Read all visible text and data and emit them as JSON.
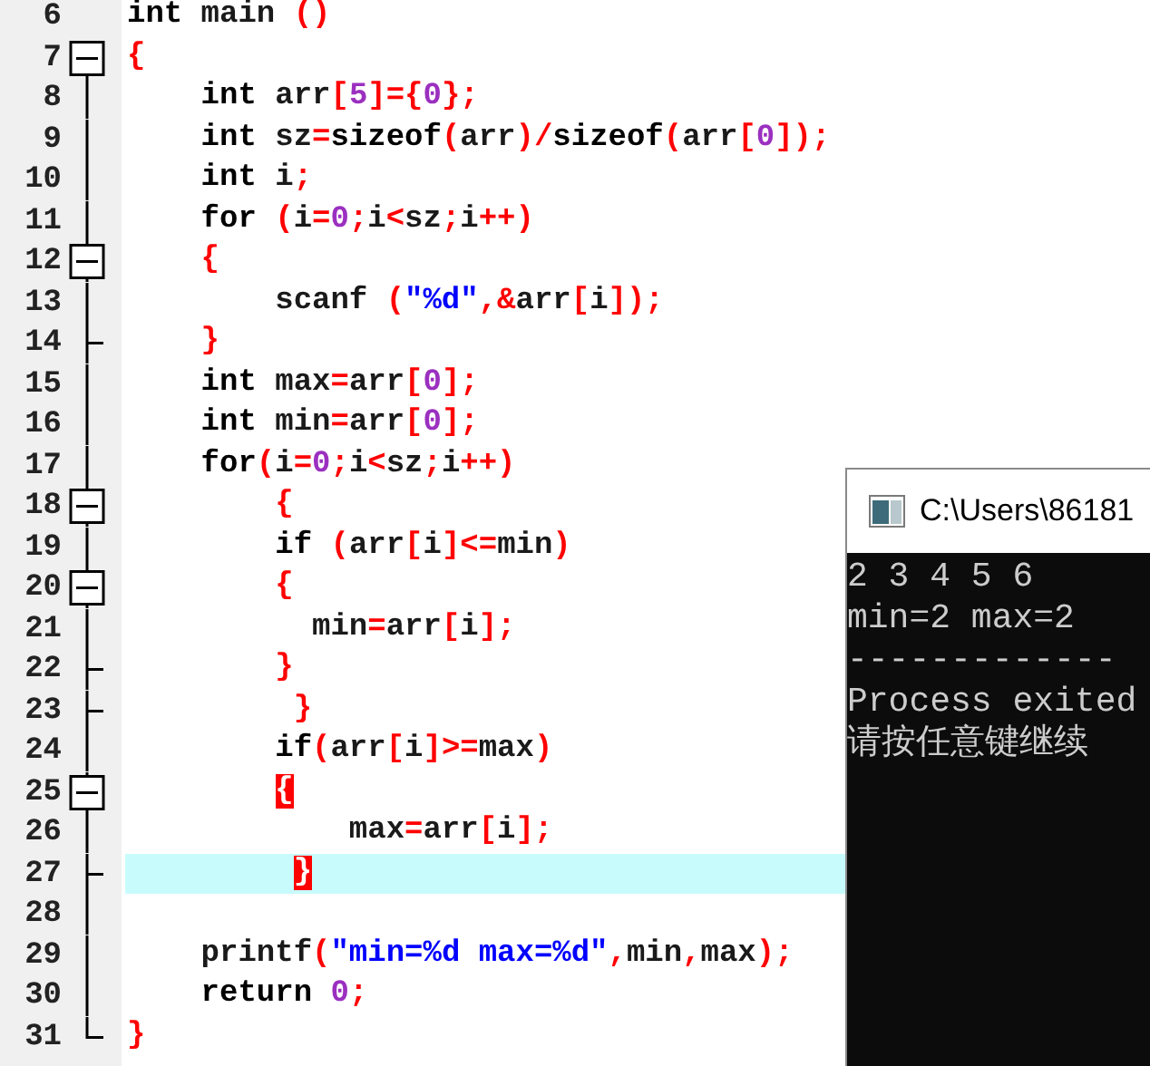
{
  "editor": {
    "lines": [
      {
        "number": "6",
        "kind": "plain",
        "current": false,
        "tokens": [
          {
            "text": "int",
            "kind": "kw"
          },
          {
            "text": " main ",
            "kind": "id"
          },
          {
            "text": "()",
            "kind": "op"
          }
        ]
      },
      {
        "number": "7",
        "kind": "open",
        "current": false,
        "tokens": [
          {
            "text": "{",
            "kind": "op"
          }
        ]
      },
      {
        "number": "8",
        "kind": "bar",
        "current": false,
        "tokens": [
          {
            "text": "    int",
            "kind": "kw"
          },
          {
            "text": " arr",
            "kind": "id"
          },
          {
            "text": "[",
            "kind": "op"
          },
          {
            "text": "5",
            "kind": "num"
          },
          {
            "text": "]={",
            "kind": "op"
          },
          {
            "text": "0",
            "kind": "num"
          },
          {
            "text": "};",
            "kind": "op"
          }
        ]
      },
      {
        "number": "9",
        "kind": "bar",
        "current": false,
        "tokens": [
          {
            "text": "    int",
            "kind": "kw"
          },
          {
            "text": " sz",
            "kind": "id"
          },
          {
            "text": "=",
            "kind": "op"
          },
          {
            "text": "sizeof",
            "kind": "kw"
          },
          {
            "text": "(",
            "kind": "op"
          },
          {
            "text": "arr",
            "kind": "id"
          },
          {
            "text": ")/",
            "kind": "op"
          },
          {
            "text": "sizeof",
            "kind": "kw"
          },
          {
            "text": "(",
            "kind": "op"
          },
          {
            "text": "arr",
            "kind": "id"
          },
          {
            "text": "[",
            "kind": "op"
          },
          {
            "text": "0",
            "kind": "num"
          },
          {
            "text": "]);",
            "kind": "op"
          }
        ]
      },
      {
        "number": "10",
        "kind": "bar",
        "current": false,
        "tokens": [
          {
            "text": "    int",
            "kind": "kw"
          },
          {
            "text": " i",
            "kind": "id"
          },
          {
            "text": ";",
            "kind": "op"
          }
        ]
      },
      {
        "number": "11",
        "kind": "bar",
        "current": false,
        "tokens": [
          {
            "text": "    for",
            "kind": "kw"
          },
          {
            "text": " (",
            "kind": "op"
          },
          {
            "text": "i",
            "kind": "id"
          },
          {
            "text": "=",
            "kind": "op"
          },
          {
            "text": "0",
            "kind": "num"
          },
          {
            "text": ";",
            "kind": "op"
          },
          {
            "text": "i",
            "kind": "id"
          },
          {
            "text": "<",
            "kind": "op"
          },
          {
            "text": "sz",
            "kind": "id"
          },
          {
            "text": ";",
            "kind": "op"
          },
          {
            "text": "i",
            "kind": "id"
          },
          {
            "text": "++)",
            "kind": "op"
          }
        ]
      },
      {
        "number": "12",
        "kind": "branch",
        "current": false,
        "tokens": [
          {
            "text": "    {",
            "kind": "op"
          }
        ]
      },
      {
        "number": "13",
        "kind": "bar",
        "current": false,
        "tokens": [
          {
            "text": "        scanf ",
            "kind": "id"
          },
          {
            "text": "(",
            "kind": "op"
          },
          {
            "text": "\"%d\"",
            "kind": "str"
          },
          {
            "text": ",&",
            "kind": "op"
          },
          {
            "text": "arr",
            "kind": "id"
          },
          {
            "text": "[",
            "kind": "op"
          },
          {
            "text": "i",
            "kind": "id"
          },
          {
            "text": "]);",
            "kind": "op"
          }
        ]
      },
      {
        "number": "14",
        "kind": "tick",
        "current": false,
        "tokens": [
          {
            "text": "    }",
            "kind": "op"
          }
        ]
      },
      {
        "number": "15",
        "kind": "bar",
        "current": false,
        "tokens": [
          {
            "text": "    int",
            "kind": "kw"
          },
          {
            "text": " max",
            "kind": "id"
          },
          {
            "text": "=",
            "kind": "op"
          },
          {
            "text": "arr",
            "kind": "id"
          },
          {
            "text": "[",
            "kind": "op"
          },
          {
            "text": "0",
            "kind": "num"
          },
          {
            "text": "];",
            "kind": "op"
          }
        ]
      },
      {
        "number": "16",
        "kind": "bar",
        "current": false,
        "tokens": [
          {
            "text": "    int",
            "kind": "kw"
          },
          {
            "text": " min",
            "kind": "id"
          },
          {
            "text": "=",
            "kind": "op"
          },
          {
            "text": "arr",
            "kind": "id"
          },
          {
            "text": "[",
            "kind": "op"
          },
          {
            "text": "0",
            "kind": "num"
          },
          {
            "text": "];",
            "kind": "op"
          }
        ]
      },
      {
        "number": "17",
        "kind": "bar",
        "current": false,
        "tokens": [
          {
            "text": "    for",
            "kind": "kw"
          },
          {
            "text": "(",
            "kind": "op"
          },
          {
            "text": "i",
            "kind": "id"
          },
          {
            "text": "=",
            "kind": "op"
          },
          {
            "text": "0",
            "kind": "num"
          },
          {
            "text": ";",
            "kind": "op"
          },
          {
            "text": "i",
            "kind": "id"
          },
          {
            "text": "<",
            "kind": "op"
          },
          {
            "text": "sz",
            "kind": "id"
          },
          {
            "text": ";",
            "kind": "op"
          },
          {
            "text": "i",
            "kind": "id"
          },
          {
            "text": "++)",
            "kind": "op"
          }
        ]
      },
      {
        "number": "18",
        "kind": "branch",
        "current": false,
        "tokens": [
          {
            "text": "        {",
            "kind": "op"
          }
        ]
      },
      {
        "number": "19",
        "kind": "bar",
        "current": false,
        "tokens": [
          {
            "text": "        if",
            "kind": "kw"
          },
          {
            "text": " (",
            "kind": "op"
          },
          {
            "text": "arr",
            "kind": "id"
          },
          {
            "text": "[",
            "kind": "op"
          },
          {
            "text": "i",
            "kind": "id"
          },
          {
            "text": "]<=",
            "kind": "op"
          },
          {
            "text": "min",
            "kind": "id"
          },
          {
            "text": ")",
            "kind": "op"
          }
        ]
      },
      {
        "number": "20",
        "kind": "branch",
        "current": false,
        "tokens": [
          {
            "text": "        {",
            "kind": "op"
          }
        ]
      },
      {
        "number": "21",
        "kind": "bar",
        "current": false,
        "tokens": [
          {
            "text": "          min",
            "kind": "id"
          },
          {
            "text": "=",
            "kind": "op"
          },
          {
            "text": "arr",
            "kind": "id"
          },
          {
            "text": "[",
            "kind": "op"
          },
          {
            "text": "i",
            "kind": "id"
          },
          {
            "text": "];",
            "kind": "op"
          }
        ]
      },
      {
        "number": "22",
        "kind": "tick",
        "current": false,
        "tokens": [
          {
            "text": "        }",
            "kind": "op"
          }
        ]
      },
      {
        "number": "23",
        "kind": "tick",
        "current": false,
        "tokens": [
          {
            "text": "         }",
            "kind": "op"
          }
        ]
      },
      {
        "number": "24",
        "kind": "bar",
        "current": false,
        "tokens": [
          {
            "text": "        if",
            "kind": "kw"
          },
          {
            "text": "(",
            "kind": "op"
          },
          {
            "text": "arr",
            "kind": "id"
          },
          {
            "text": "[",
            "kind": "op"
          },
          {
            "text": "i",
            "kind": "id"
          },
          {
            "text": "]>=",
            "kind": "op"
          },
          {
            "text": "max",
            "kind": "id"
          },
          {
            "text": ")",
            "kind": "op"
          }
        ]
      },
      {
        "number": "25",
        "kind": "branch",
        "current": false,
        "tokens": [
          {
            "text": "        {",
            "kind": "match"
          }
        ]
      },
      {
        "number": "26",
        "kind": "bar",
        "current": false,
        "tokens": [
          {
            "text": "            max",
            "kind": "id"
          },
          {
            "text": "=",
            "kind": "op"
          },
          {
            "text": "arr",
            "kind": "id"
          },
          {
            "text": "[",
            "kind": "op"
          },
          {
            "text": "i",
            "kind": "id"
          },
          {
            "text": "];",
            "kind": "op"
          }
        ]
      },
      {
        "number": "27",
        "kind": "tick",
        "current": true,
        "tokens": [
          {
            "text": "         }",
            "kind": "match"
          }
        ]
      },
      {
        "number": "28",
        "kind": "bar",
        "current": false
      },
      {
        "number": "29",
        "kind": "bar",
        "current": false,
        "tokens": [
          {
            "text": "    printf",
            "kind": "id"
          },
          {
            "text": "(",
            "kind": "op"
          },
          {
            "text": "\"min=%d max=%d\"",
            "kind": "str"
          },
          {
            "text": ",",
            "kind": "op"
          },
          {
            "text": "min",
            "kind": "id"
          },
          {
            "text": ",",
            "kind": "op"
          },
          {
            "text": "max",
            "kind": "id"
          },
          {
            "text": ");",
            "kind": "op"
          }
        ]
      },
      {
        "number": "30",
        "kind": "bar",
        "current": false,
        "tokens": [
          {
            "text": "    return",
            "kind": "kw"
          },
          {
            "text": " 0",
            "kind": "num"
          },
          {
            "text": ";",
            "kind": "op"
          }
        ]
      },
      {
        "number": "31",
        "kind": "close",
        "current": false,
        "tokens": [
          {
            "text": "}",
            "kind": "op"
          }
        ]
      }
    ]
  },
  "console": {
    "title": "C:\\Users\\86181",
    "lines": [
      "2 3 4 5 6",
      "min=2 max=2",
      "-------------",
      "Process exited",
      "请按任意键继续"
    ]
  }
}
